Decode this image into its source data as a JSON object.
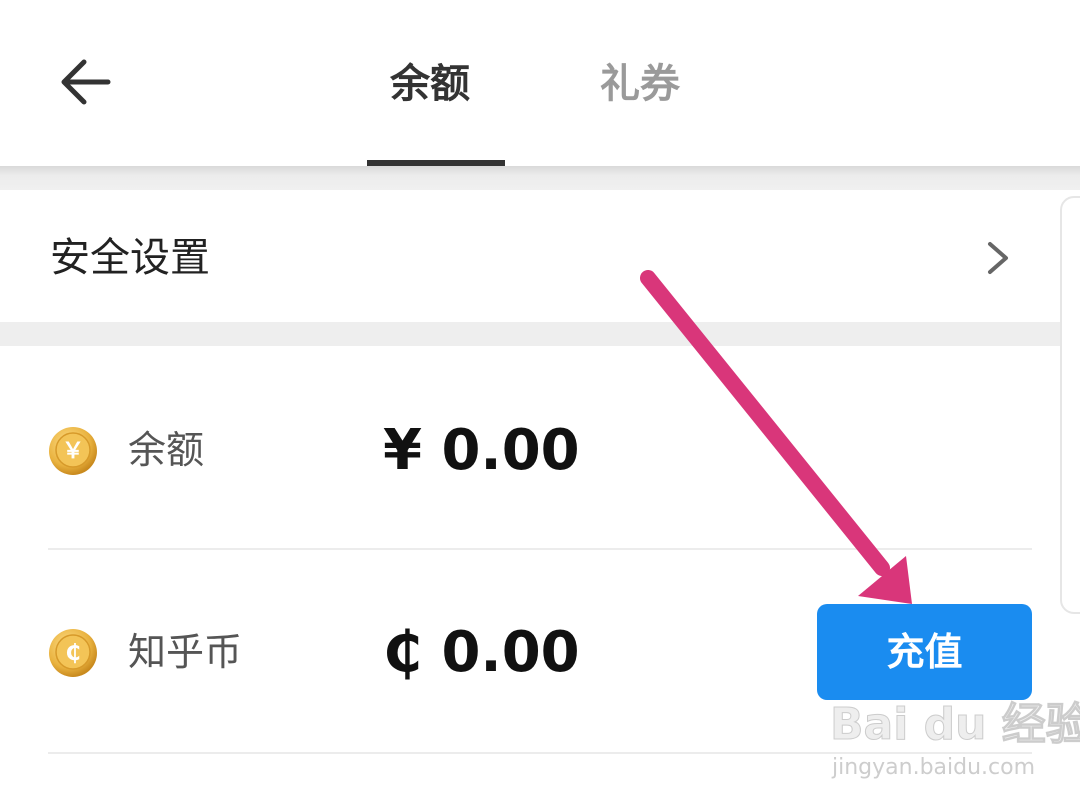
{
  "header": {
    "tabs": [
      {
        "label": "余额",
        "active": true
      },
      {
        "label": "礼券",
        "active": false
      }
    ]
  },
  "security": {
    "label": "安全设置"
  },
  "wallet": {
    "balance": {
      "label": "余额",
      "amount": "¥ 0.00",
      "coin_symbol": "￥"
    },
    "zhihu_coin": {
      "label": "知乎币",
      "amount": "₵ 0.00",
      "coin_symbol": "₵",
      "button_label": "充值"
    }
  },
  "watermark": {
    "main": "Bai du 经验",
    "sub": "jingyan.baidu.com"
  },
  "colors": {
    "accent": "#1a8cf0",
    "annotation_arrow": "#d9367a",
    "coin": "#e9b23f"
  }
}
